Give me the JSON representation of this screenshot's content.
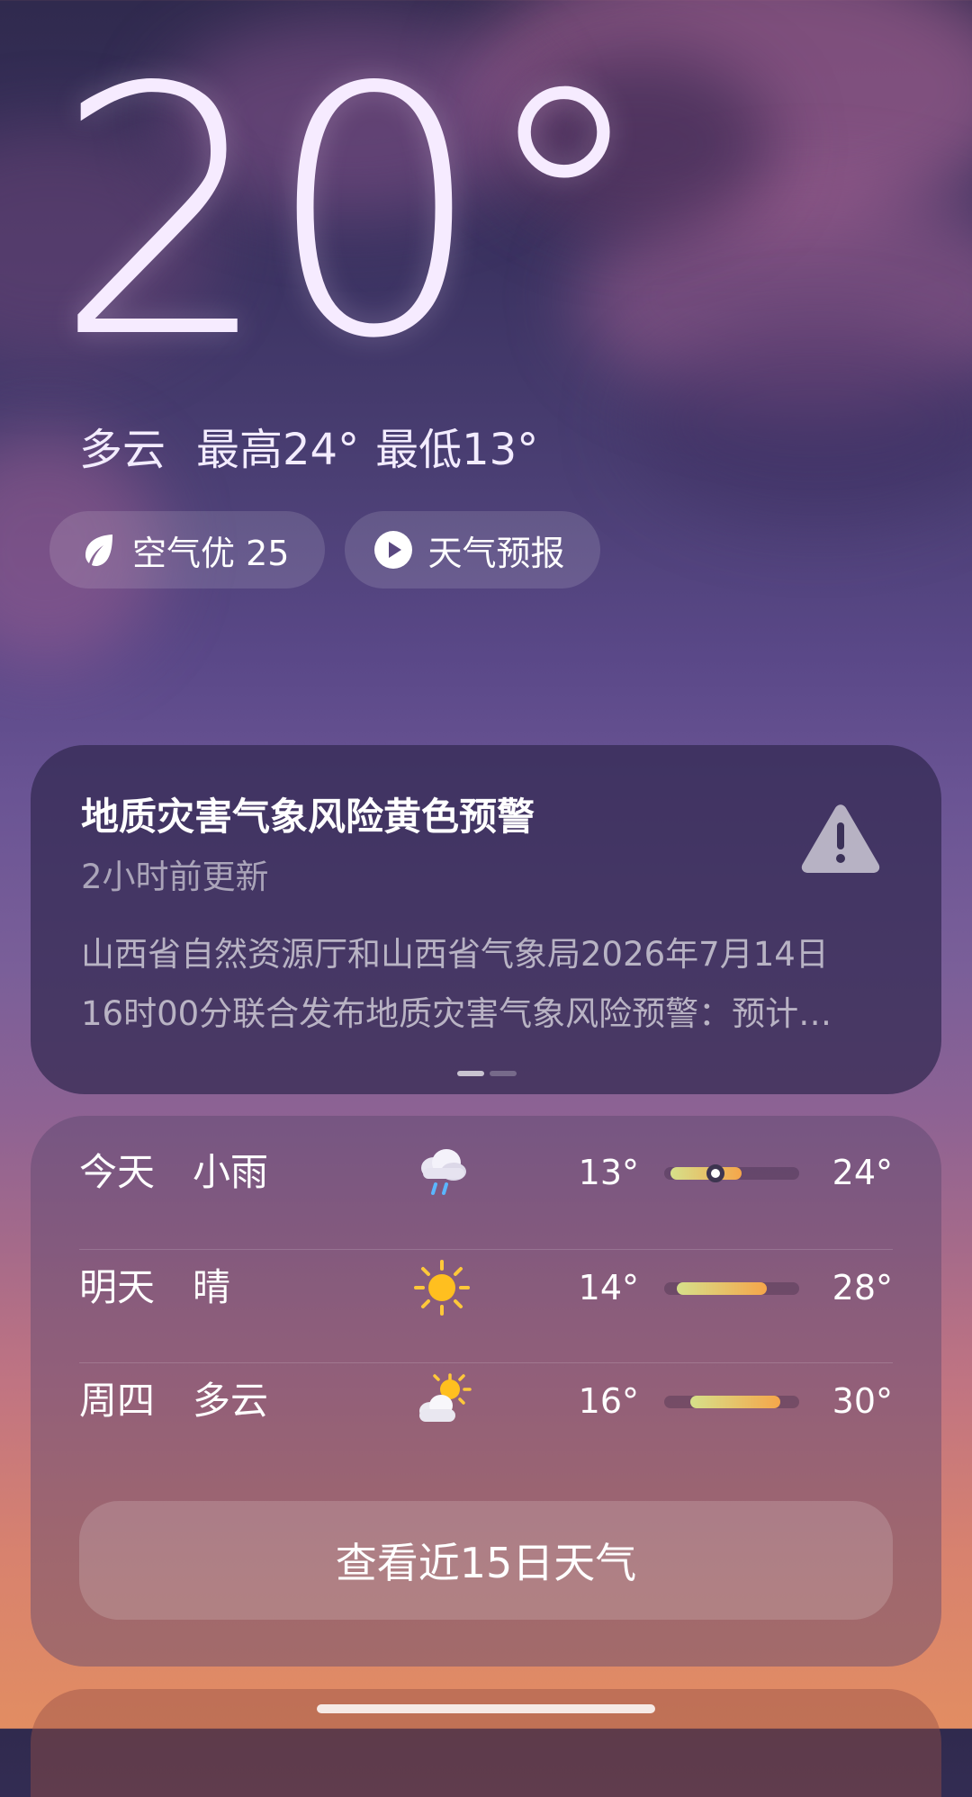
{
  "current": {
    "temperature": "20°",
    "condition": "多云",
    "high": "最高24°",
    "low": "最低13°"
  },
  "chips": {
    "air_quality": "空气优 25",
    "forecast_video": "天气预报"
  },
  "alert": {
    "title": "地质灾害气象风险黄色预警",
    "updated": "2小时前更新",
    "body_line1": "山西省自然资源厅和山西省气象局2026年7月14日",
    "body_line2": "16时00分联合发布地质灾害气象风险预警：预计…"
  },
  "forecast": {
    "days": [
      {
        "day": "今天",
        "condition": "小雨",
        "icon": "light-rain-icon",
        "low": "13°",
        "high": "24°",
        "low_value": 13,
        "high_value": 24,
        "current_value": 20
      },
      {
        "day": "明天",
        "condition": "晴",
        "icon": "sunny-icon",
        "low": "14°",
        "high": "28°",
        "low_value": 14,
        "high_value": 28
      },
      {
        "day": "周四",
        "condition": "多云",
        "icon": "partly-cloudy-icon",
        "low": "16°",
        "high": "30°",
        "low_value": 16,
        "high_value": 30
      }
    ],
    "button_label": "查看近15日天气"
  },
  "colors": {
    "bar_cool": "#d6e08a",
    "bar_warm": "#f5a64a"
  }
}
